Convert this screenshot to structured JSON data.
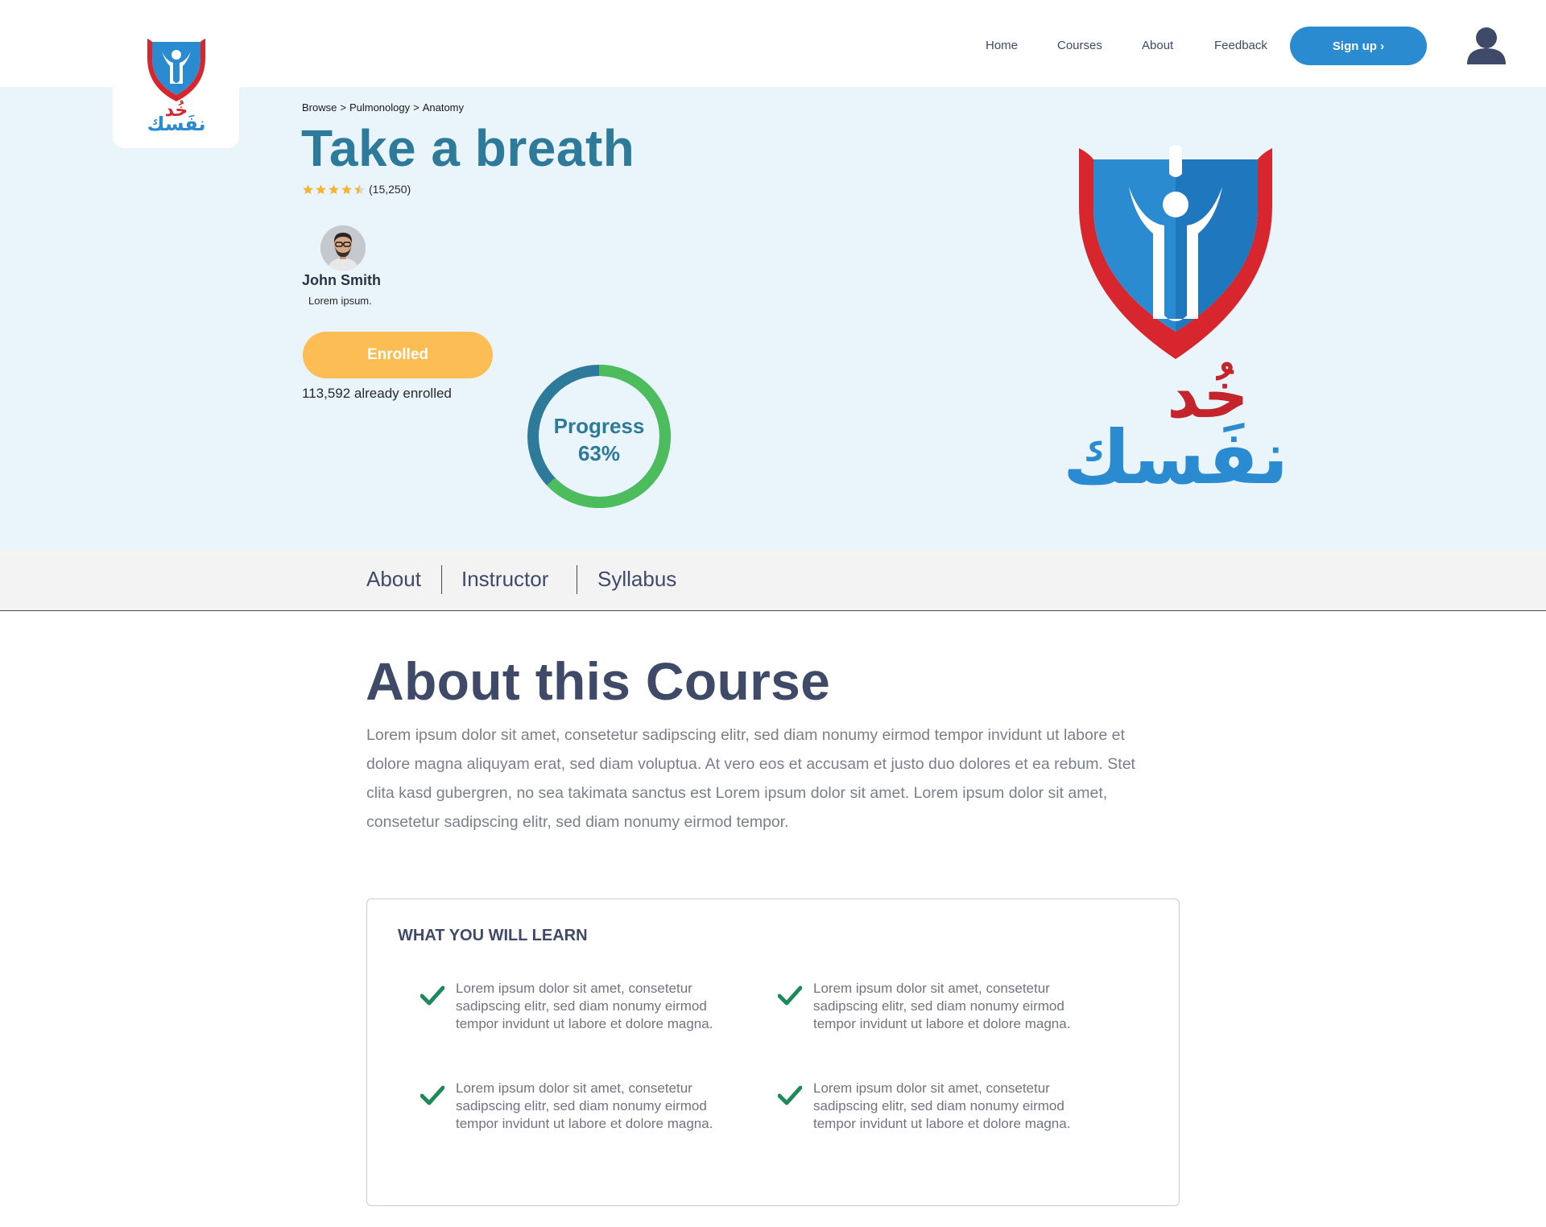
{
  "brand": {
    "logo_text": "خُد نفَسك"
  },
  "nav": {
    "links": [
      "Home",
      "Courses",
      "About",
      "Feedback"
    ],
    "signup_label": "Sign up ›"
  },
  "hero": {
    "breadcrumb": [
      "Browse",
      ">",
      "Pulmonology",
      ">",
      "Anatomy"
    ],
    "title": "Take a breath",
    "rating": {
      "stars": 4.5,
      "count_label": "(15,250)"
    },
    "instructor": {
      "name": "John Smith",
      "role": "Lorem ipsum."
    },
    "enrolled_label": "Enrolled",
    "enrolled_count": "113,592 already enrolled",
    "progress": {
      "label": "Progress",
      "value_label": "63%",
      "value": 0.63
    }
  },
  "tabs": [
    "About",
    "Instructor",
    "Syllabus"
  ],
  "about": {
    "heading": "About this Course",
    "body": "Lorem ipsum dolor sit amet, consetetur sadipscing elitr, sed diam nonumy eirmod tempor invidunt ut labore et dolore magna aliquyam erat, sed diam voluptua. At vero eos et accusam et justo duo dolores et ea rebum. Stet clita kasd gubergren, no sea takimata sanctus est Lorem ipsum dolor sit amet. Lorem ipsum dolor sit amet, consetetur sadipscing elitr, sed diam nonumy eirmod tempor."
  },
  "learn": {
    "title": "WHAT YOU WILL LEARN",
    "items": [
      "Lorem ipsum dolor sit amet, consetetur sadipscing elitr, sed diam nonumy eirmod tempor invidunt ut labore et dolore magna.",
      "Lorem ipsum dolor sit amet, consetetur sadipscing elitr, sed diam nonumy eirmod tempor invidunt ut labore et dolore magna.",
      "Lorem ipsum dolor sit amet, consetetur sadipscing elitr, sed diam nonumy eirmod tempor invidunt ut labore et dolore magna.",
      "Lorem ipsum dolor sit amet, consetetur sadipscing elitr, sed diam nonumy eirmod tempor invidunt ut labore et dolore magna."
    ]
  },
  "colors": {
    "accent_blue": "#2a8bd1",
    "title_teal": "#2d7a9b",
    "enrolled_orange": "#fdbd55",
    "progress_green": "#4cbc5c",
    "check_green": "#1e8a5a",
    "logo_red": "#d7262e"
  }
}
